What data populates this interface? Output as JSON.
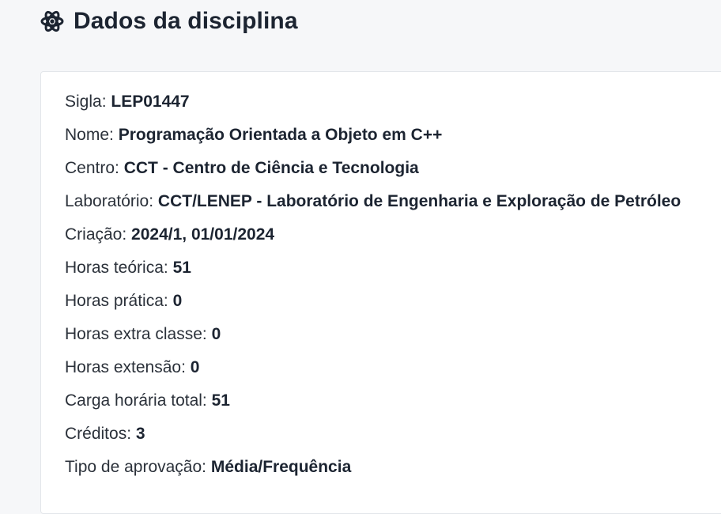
{
  "header": {
    "title": "Dados da disciplina",
    "icon": "atom-icon"
  },
  "colors": {
    "background": "#f6f7f9",
    "card": "#ffffff",
    "text": "#1c2431"
  },
  "fields": [
    {
      "label": "Sigla:",
      "value": "LEP01447"
    },
    {
      "label": "Nome:",
      "value": "Programação Orientada a Objeto em C++"
    },
    {
      "label": "Centro:",
      "value": "CCT - Centro de Ciência e Tecnologia"
    },
    {
      "label": "Laboratório:",
      "value": "CCT/LENEP - Laboratório de Engenharia e Exploração de Petróleo"
    },
    {
      "label": "Criação:",
      "value": "2024/1, 01/01/2024"
    },
    {
      "label": "Horas teórica:",
      "value": "51"
    },
    {
      "label": "Horas prática:",
      "value": "0"
    },
    {
      "label": "Horas extra classe:",
      "value": "0"
    },
    {
      "label": "Horas extensão:",
      "value": "0"
    },
    {
      "label": "Carga horária total:",
      "value": "51"
    },
    {
      "label": "Créditos:",
      "value": "3"
    },
    {
      "label": "Tipo de aprovação:",
      "value": "Média/Frequência"
    }
  ]
}
